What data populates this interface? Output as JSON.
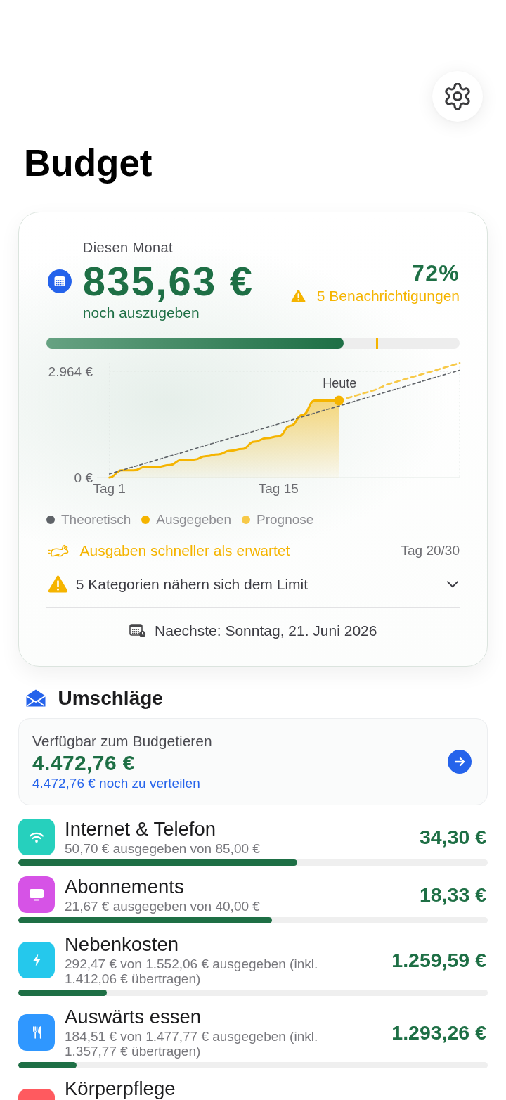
{
  "header": {
    "title": "Budget"
  },
  "month": {
    "label": "Diesen Monat",
    "amount": "835,63 €",
    "amount_caption": "noch auszugeben",
    "percent": "72%",
    "alerts": "5 Benachrichtigungen",
    "progress": {
      "level": 0.72,
      "marker": {
        "level": 0.8
      }
    },
    "chart_data": {
      "type": "line",
      "categories": [
        "Tag 1",
        null,
        null,
        null,
        null,
        null,
        null,
        null,
        null,
        null,
        null,
        null,
        null,
        null,
        "Tag 15",
        null,
        null,
        null,
        null,
        null,
        null,
        null,
        null,
        null,
        null,
        null,
        null,
        null,
        null,
        null
      ],
      "series": [
        {
          "name": "Theoretisch",
          "color": "#5f6368",
          "line_style": "dashed",
          "values": [
            100,
            200,
            300,
            400,
            500,
            600,
            700,
            800,
            900,
            1000,
            1100,
            1200,
            1300,
            1400,
            1500,
            1600,
            1700,
            1800,
            1900,
            2000,
            2100,
            2200,
            2300,
            2400,
            2500,
            2600,
            2700,
            2800,
            2900,
            3000
          ]
        },
        {
          "name": "Ausgegeben",
          "color": "#f5b400",
          "line_style": "solid",
          "values": [
            0,
            200,
            200,
            300,
            300,
            350,
            500,
            500,
            600,
            650,
            750,
            800,
            1000,
            1100,
            1150,
            1450,
            1750,
            2150,
            2150,
            2150,
            null,
            null,
            null,
            null,
            null,
            null,
            null,
            null,
            null,
            null
          ]
        },
        {
          "name": "Prognose",
          "color": "#f7c948",
          "line_style": "dashed",
          "values": [
            null,
            null,
            null,
            null,
            null,
            null,
            null,
            null,
            null,
            null,
            null,
            null,
            null,
            null,
            null,
            null,
            null,
            null,
            null,
            2150,
            2250,
            2350,
            2450,
            2600,
            2700,
            2800,
            2900,
            3000,
            3100,
            3200
          ]
        }
      ],
      "ylim": [
        0,
        3200
      ],
      "yticks": [
        {
          "value": 0,
          "label": "0 €"
        },
        {
          "value": 2964,
          "label": "2.964 €"
        }
      ],
      "annotations": [
        {
          "text": "Heute"
        }
      ]
    },
    "pace": {
      "message": "Ausgaben schneller als erwartet",
      "day": "Tag 20/30"
    },
    "limit_warning": {
      "text": "5 Kategorien nähern sich dem Limit",
      "expanded": false
    },
    "next_date": "Naechste: Sonntag, 21. Juni 2026"
  },
  "envelopes": {
    "title": "Umschläge",
    "available": {
      "label": "Verfügbar zum Budgetieren",
      "amount": "4.472,76 €",
      "note": "4.472,76 € noch zu verteilen"
    },
    "categories": [
      {
        "name": "Internet & Telefon",
        "kind": "internet",
        "color": "#26d0bd",
        "detail": "50,70 € ausgegeben von 85,00 €",
        "amount": "34,30 €",
        "level": 0.594
      },
      {
        "name": "Abonnements",
        "kind": "subscriptions",
        "color": "#d653e6",
        "detail": "21,67 € ausgegeben von 40,00 €",
        "amount": "18,33 €",
        "level": 0.54
      },
      {
        "name": "Nebenkosten",
        "kind": "utilities",
        "color": "#25c8ec",
        "detail": "292,47 € von 1.552,06 € ausgegeben (inkl. 1.412,06 € übertragen)",
        "amount": "1.259,59 €",
        "level": 0.188
      },
      {
        "name": "Auswärts essen",
        "kind": "dining",
        "color": "#2f97ff",
        "detail": "184,51 € von 1.477,77 € ausgegeben (inkl. 1.357,77 € übertragen)",
        "amount": "1.293,26 €",
        "level": 0.124
      },
      {
        "name": "Körperpflege",
        "kind": "personal-care",
        "color": "#ff5a5f"
      }
    ]
  }
}
